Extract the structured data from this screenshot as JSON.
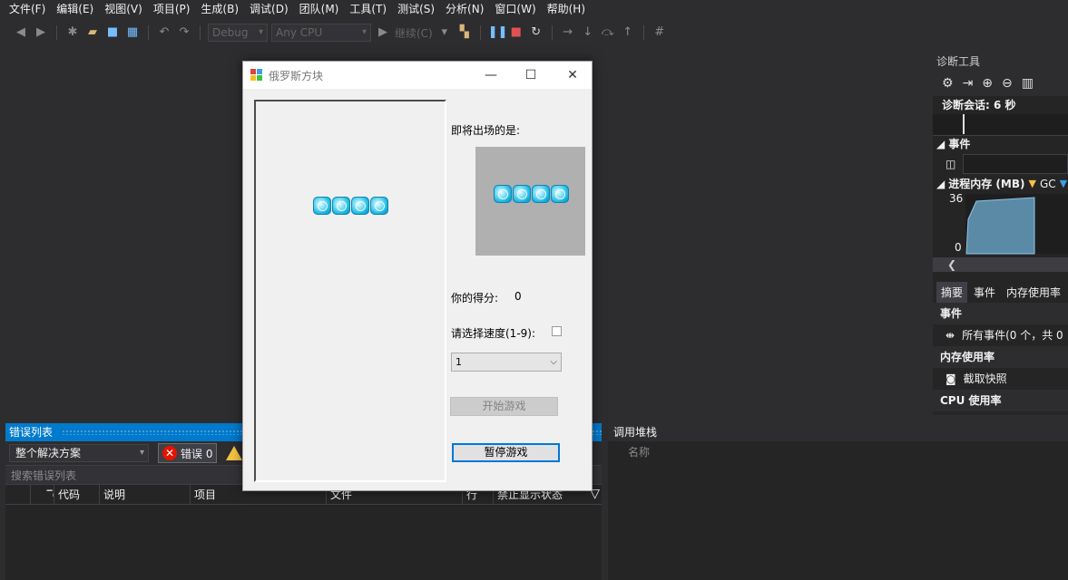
{
  "menu": [
    "文件(F)",
    "编辑(E)",
    "视图(V)",
    "项目(P)",
    "生成(B)",
    "调试(D)",
    "团队(M)",
    "工具(T)",
    "测试(S)",
    "分析(N)",
    "窗口(W)",
    "帮助(H)"
  ],
  "toolbar": {
    "config": "Debug",
    "platform": "Any CPU",
    "continue_label": "继续(C)"
  },
  "diagnostics": {
    "title": "诊断工具",
    "session": "诊断会话: 6 秒",
    "events_header": "事件",
    "memory_header": "进程内存 (MB)",
    "gc_label": "GC",
    "mem_max": "36",
    "mem_min": "0",
    "tabs": [
      "摘要",
      "事件",
      "内存使用率"
    ],
    "events_block": "事件",
    "all_events": "所有事件(0 个，共 0",
    "memory_block": "内存使用率",
    "snapshot": "截取快照",
    "cpu_block": "CPU 使用率"
  },
  "error_list": {
    "title": "错误列表",
    "scope": "整个解决方案",
    "errors_label": "错误 0",
    "search_placeholder": "搜索错误列表",
    "columns": [
      "代码",
      "说明",
      "项目",
      "文件",
      "行",
      "禁止显示状态"
    ]
  },
  "call_stack": {
    "title": "调用堆栈",
    "name_col": "名称"
  },
  "game": {
    "title": "俄罗斯方块",
    "next_label": "即将出场的是:",
    "score_label": "你的得分:",
    "score_value": "0",
    "speed_label": "请选择速度(1-9):",
    "speed_value": "1",
    "start_button": "开始游戏",
    "pause_button": "暂停游戏"
  }
}
